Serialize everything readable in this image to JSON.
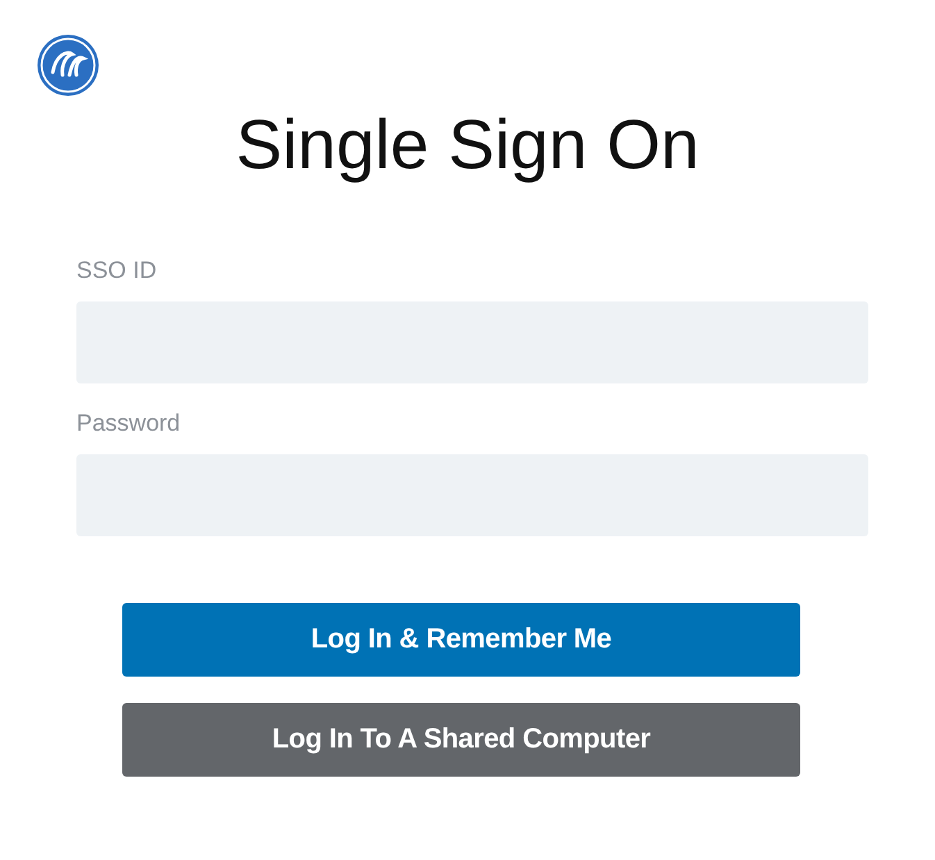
{
  "title": "Single Sign On",
  "fields": [
    {
      "label": "SSO ID"
    },
    {
      "label": "Password"
    }
  ],
  "buttons": [
    {
      "label": "Log In & Remember Me",
      "kind": "primary"
    },
    {
      "label": "Log In To A Shared Computer",
      "kind": "secondary"
    }
  ]
}
